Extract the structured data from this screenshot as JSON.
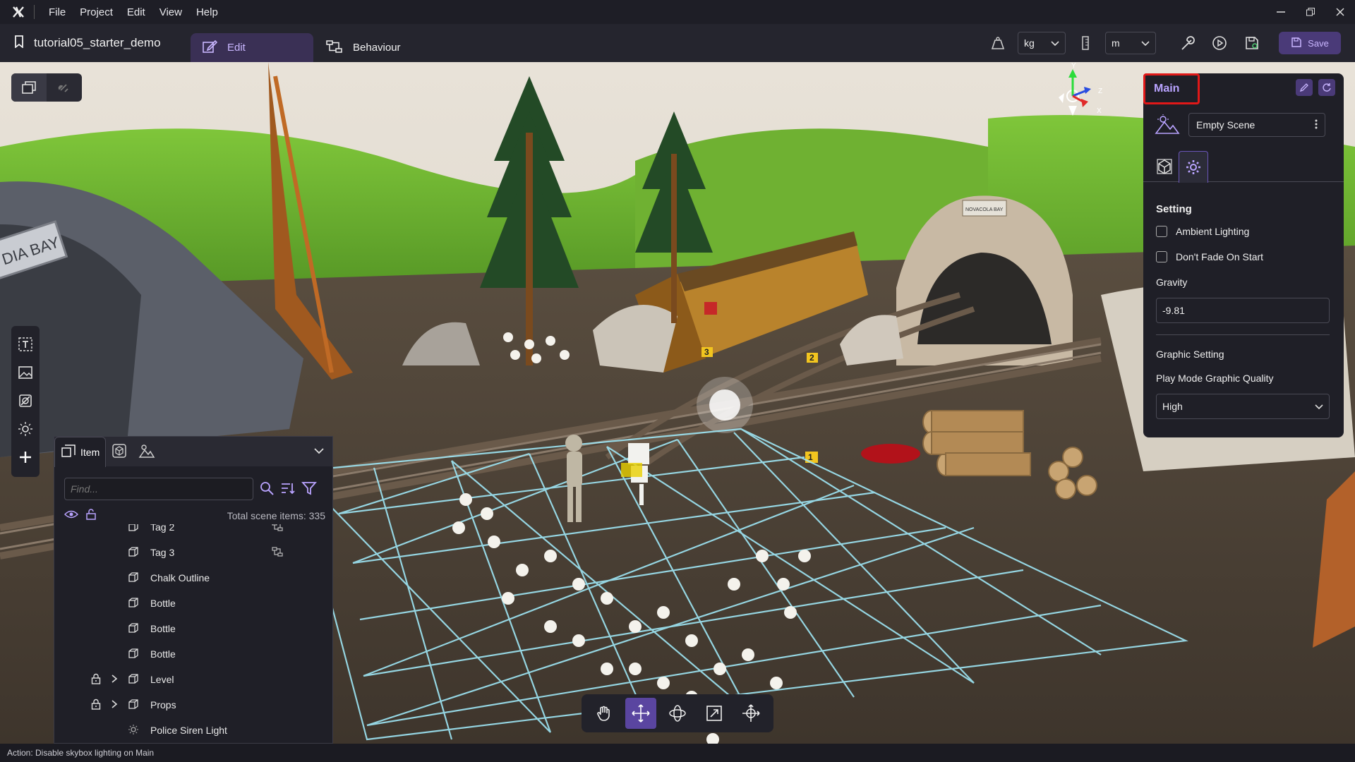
{
  "menu": {
    "items": [
      "File",
      "Project",
      "Edit",
      "View",
      "Help"
    ]
  },
  "toolbar": {
    "project_name": "tutorial05_starter_demo",
    "tabs": {
      "edit": "Edit",
      "behaviour": "Behaviour"
    },
    "mass_unit": "kg",
    "length_unit": "m",
    "save_label": "Save"
  },
  "hierarchy": {
    "tabs": {
      "item": "Item"
    },
    "search_placeholder": "Find...",
    "total_label": "Total scene items: 335",
    "items": [
      {
        "label": "Tag 2",
        "icon": "cube-icon",
        "behaviour": true
      },
      {
        "label": "Tag 3",
        "icon": "cube-icon",
        "behaviour": true
      },
      {
        "label": "Chalk Outline",
        "icon": "cube-icon"
      },
      {
        "label": "Bottle",
        "icon": "cube-icon"
      },
      {
        "label": "Bottle",
        "icon": "cube-icon"
      },
      {
        "label": "Bottle",
        "icon": "cube-icon"
      },
      {
        "label": "Level",
        "icon": "cube-icon",
        "locked": true,
        "expandable": true
      },
      {
        "label": "Props",
        "icon": "cube-icon",
        "locked": true,
        "expandable": true
      },
      {
        "label": "Police Siren Light",
        "icon": "light-icon"
      }
    ]
  },
  "properties": {
    "title": "Main",
    "scene_select": "Empty Scene",
    "setting_title": "Setting",
    "ambient_lighting": "Ambient Lighting",
    "dont_fade": "Don't Fade On Start",
    "gravity_label": "Gravity",
    "gravity_value": "-9.81",
    "graphic_setting": "Graphic Setting",
    "play_mode_quality_label": "Play Mode Graphic Quality",
    "play_mode_quality_value": "High"
  },
  "viewport": {
    "axis": {
      "y": "Y",
      "z": "Z",
      "x": "X"
    },
    "signs": {
      "left": "DIA BAY",
      "tunnel": "NOVACOLA BAY"
    },
    "evidence_tags": [
      "1",
      "2",
      "3"
    ]
  },
  "status": {
    "text": "Action: Disable skybox lighting on Main"
  },
  "colors": {
    "accent": "#5a45a0",
    "accent_text": "#b9a3ff",
    "highlight_border": "#e01818"
  }
}
